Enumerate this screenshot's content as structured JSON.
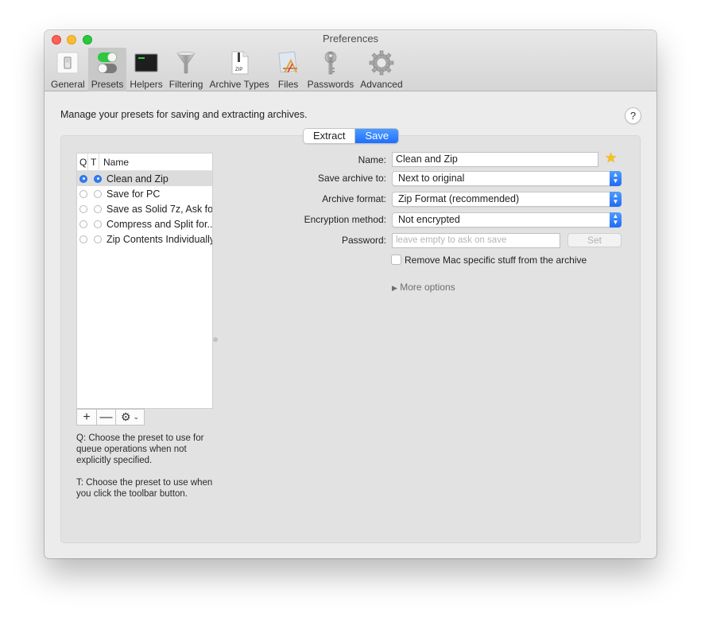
{
  "window": {
    "title": "Preferences"
  },
  "toolbar": {
    "items": [
      {
        "label": "General",
        "icon": "general-switch-icon",
        "active": false
      },
      {
        "label": "Presets",
        "icon": "presets-toggles-icon",
        "active": true
      },
      {
        "label": "Helpers",
        "icon": "terminal-icon",
        "active": false
      },
      {
        "label": "Filtering",
        "icon": "funnel-icon",
        "active": false
      },
      {
        "label": "Archive Types",
        "icon": "zip-file-icon",
        "active": false
      },
      {
        "label": "Files",
        "icon": "app-file-icon",
        "active": false
      },
      {
        "label": "Passwords",
        "icon": "key-icon",
        "active": false
      },
      {
        "label": "Advanced",
        "icon": "gear-icon",
        "active": false
      }
    ]
  },
  "main": {
    "description": "Manage your presets for saving and extracting archives.",
    "help_label": "?",
    "segments": [
      {
        "label": "Extract",
        "selected": false
      },
      {
        "label": "Save",
        "selected": true
      }
    ],
    "presets": {
      "headers": {
        "q": "Q",
        "t": "T",
        "name": "Name"
      },
      "rows": [
        {
          "name": "Clean and Zip",
          "q": true,
          "t": true,
          "selected": true
        },
        {
          "name": "Save for PC",
          "q": false,
          "t": false,
          "selected": false
        },
        {
          "name": "Save as Solid 7z, Ask fo...",
          "q": false,
          "t": false,
          "selected": false
        },
        {
          "name": "Compress and Split for...",
          "q": false,
          "t": false,
          "selected": false
        },
        {
          "name": "Zip Contents Individually",
          "q": false,
          "t": false,
          "selected": false
        }
      ],
      "buttons": {
        "add": "+",
        "remove": "—",
        "gear_menu": "⚙"
      }
    },
    "help_text": {
      "q": "Q: Choose the preset to use for queue operations when not explicitly specified.",
      "t": "T: Choose the preset to use when you click the toolbar button."
    },
    "form": {
      "name_label": "Name:",
      "name_value": "Clean and Zip",
      "save_to_label": "Save archive to:",
      "save_to_value": "Next to original",
      "format_label": "Archive format:",
      "format_value": "Zip Format (recommended)",
      "encryption_label": "Encryption method:",
      "encryption_value": "Not encrypted",
      "password_label": "Password:",
      "password_value": "",
      "password_placeholder": "leave empty to ask on save",
      "set_button": "Set",
      "remove_mac_label": "Remove Mac specific stuff from the archive",
      "remove_mac_checked": false,
      "more_options": "More options"
    }
  }
}
